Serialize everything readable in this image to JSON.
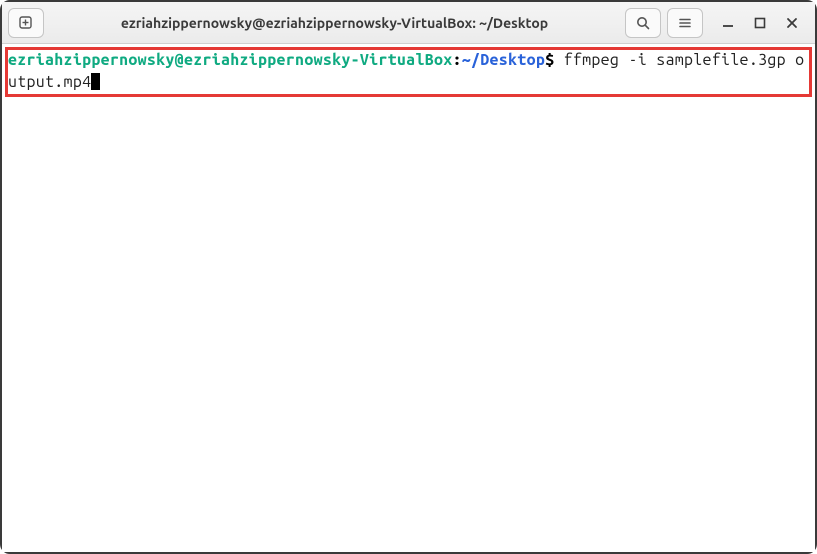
{
  "titlebar": {
    "title": "ezriahzippernowsky@ezriahzippernowsky-VirtualBox: ~/Desktop"
  },
  "terminal": {
    "prompt": {
      "user_host": "ezriahzippernowsky@ezriahzippernowsky-VirtualBox",
      "separator": ":",
      "path": "~/Desktop",
      "symbol": "$"
    },
    "command": " ffmpeg -i samplefile.3gp output.mp4"
  },
  "icons": {
    "new_tab": "new-tab-icon",
    "search": "search-icon",
    "menu": "hamburger-icon",
    "minimize": "minimize-icon",
    "maximize": "maximize-icon",
    "close": "close-icon"
  }
}
